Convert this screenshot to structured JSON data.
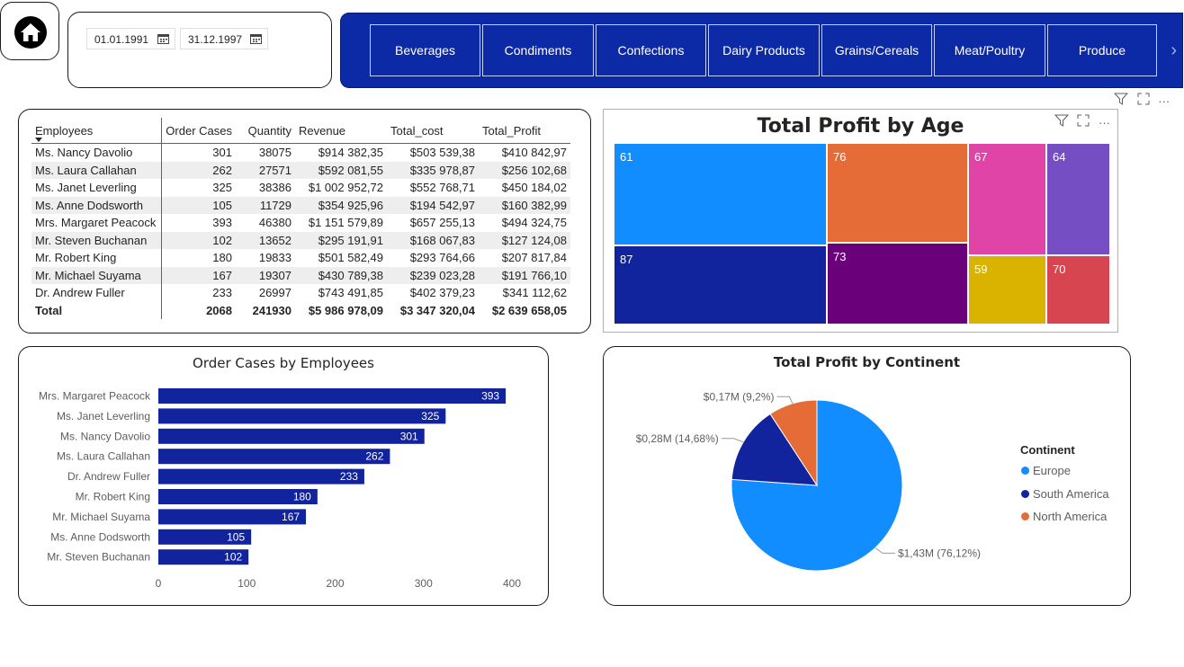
{
  "dates": {
    "start": "01.01.1991",
    "end": "31.12.1997"
  },
  "categories": [
    "Beverages",
    "Condiments",
    "Confections",
    "Dairy Products",
    "Grains/Cereals",
    "Meat/Poultry",
    "Produce"
  ],
  "table": {
    "headers": [
      "Employees",
      "Order Cases",
      "Quantity",
      "Revenue",
      "Total_cost",
      "Total_Profit"
    ],
    "rows": [
      [
        "Ms. Nancy Davolio",
        "301",
        "38075",
        "$914 382,35",
        "$503 539,38",
        "$410 842,97"
      ],
      [
        "Ms. Laura Callahan",
        "262",
        "27571",
        "$592 081,55",
        "$335 978,87",
        "$256 102,68"
      ],
      [
        "Ms. Janet Leverling",
        "325",
        "38386",
        "$1 002 952,72",
        "$552 768,71",
        "$450 184,02"
      ],
      [
        "Ms. Anne Dodsworth",
        "105",
        "11729",
        "$354 925,96",
        "$194 542,97",
        "$160 382,99"
      ],
      [
        "Mrs. Margaret Peacock",
        "393",
        "46380",
        "$1 151 579,89",
        "$657 255,13",
        "$494 324,75"
      ],
      [
        "Mr. Steven Buchanan",
        "102",
        "13652",
        "$295 191,91",
        "$168 067,83",
        "$127 124,08"
      ],
      [
        "Mr. Robert King",
        "180",
        "19833",
        "$501 582,49",
        "$293 764,66",
        "$207 817,84"
      ],
      [
        "Mr. Michael Suyama",
        "167",
        "19307",
        "$430 789,38",
        "$239 023,28",
        "$191 766,10"
      ],
      [
        "Dr. Andrew Fuller",
        "233",
        "26997",
        "$743 491,85",
        "$402 379,23",
        "$341 112,62"
      ]
    ],
    "total": [
      "Total",
      "2068",
      "241930",
      "$5 986 978,09",
      "$3 347 320,04",
      "$2 639 658,05"
    ]
  },
  "treemap": {
    "title": "Total Profit by Age",
    "cells": [
      {
        "label": "61",
        "color": "#118dff"
      },
      {
        "label": "87",
        "color": "#12239e"
      },
      {
        "label": "76",
        "color": "#e66c37"
      },
      {
        "label": "73",
        "color": "#6b007b"
      },
      {
        "label": "67",
        "color": "#e044a7"
      },
      {
        "label": "64",
        "color": "#744ec2"
      },
      {
        "label": "59",
        "color": "#d9b300"
      },
      {
        "label": "70",
        "color": "#d64550"
      }
    ]
  },
  "chart_data": [
    {
      "type": "bar",
      "orientation": "horizontal",
      "title": "Order Cases by Employees",
      "categories": [
        "Mrs. Margaret Peacock",
        "Ms. Janet Leverling",
        "Ms. Nancy Davolio",
        "Ms. Laura Callahan",
        "Dr. Andrew Fuller",
        "Mr. Robert King",
        "Mr. Michael Suyama",
        "Ms. Anne Dodsworth",
        "Mr. Steven Buchanan"
      ],
      "values": [
        393,
        325,
        301,
        262,
        233,
        180,
        167,
        105,
        102
      ],
      "xticks": [
        "0",
        "100",
        "200",
        "300",
        "400"
      ],
      "xlim": [
        0,
        400
      ],
      "color": "#12239e",
      "grid": false
    },
    {
      "type": "pie",
      "title": "Total Profit by Continent",
      "legend_title": "Continent",
      "legend_position": "right",
      "slices": [
        {
          "name": "Europe",
          "value": 76.12,
          "label": "$1,43M (76,12%)",
          "color": "#118dff"
        },
        {
          "name": "South America",
          "value": 14.68,
          "label": "$0,28M (14,68%)",
          "color": "#12239e"
        },
        {
          "name": "North America",
          "value": 9.2,
          "label": "$0,17M (9,2%)",
          "color": "#e66c37"
        }
      ]
    }
  ]
}
